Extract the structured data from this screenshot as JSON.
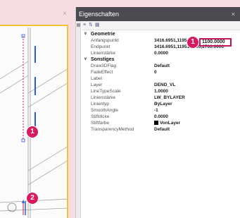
{
  "panel_title": "Eigenschaften",
  "close_glyph": "×",
  "toolbar": {
    "icons": [
      "list-icon",
      "sort-icon",
      "filter-icon"
    ]
  },
  "groups": [
    {
      "title": "Geometrie",
      "rows": [
        {
          "name": "Anfangspunkt",
          "value": "3416.6951,1195"
        },
        {
          "name": "Endpunkt",
          "value": "3416.6951,11951.8595,2700.0000"
        },
        {
          "name": "Linienstärke",
          "value": "0.0000"
        }
      ]
    },
    {
      "title": "Sonstiges",
      "rows": [
        {
          "name": "Draw3DFlag",
          "value": "Default"
        },
        {
          "name": "FadeEffect",
          "value": "0"
        },
        {
          "name": "Label",
          "value": ""
        },
        {
          "name": "Layer",
          "value": "DEND_VL"
        },
        {
          "name": "LineTypeScale",
          "value": "1.0000"
        },
        {
          "name": "Linienstärke",
          "value": "LW_BYLAYER"
        },
        {
          "name": "Linientyp",
          "value": "ByLayer"
        },
        {
          "name": "SmoothAngle",
          "value": "-1"
        },
        {
          "name": "Stiftdicke",
          "value": "0.0000"
        },
        {
          "name": "Stiftfarbe",
          "value": "VonLayer"
        },
        {
          "name": "TransparencyMethod",
          "value": "Default"
        }
      ]
    }
  ],
  "highlighted_value": "1100.0000",
  "markers": {
    "marker1": "1",
    "marker2": "1",
    "marker3": "2"
  },
  "colors": {
    "accent": "#d81b60",
    "frame": "#f1c232",
    "titlebar": "#4b4b4f",
    "line_blue": "#2f5bd8",
    "line_red": "#c2185b"
  }
}
